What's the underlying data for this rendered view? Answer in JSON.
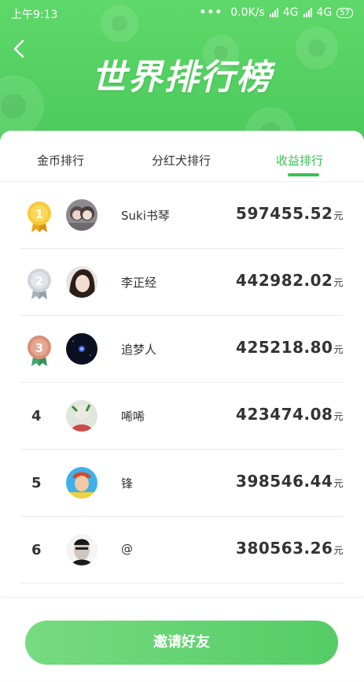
{
  "status_bar": {
    "time": "上午9:13",
    "speed": "0.0K/s",
    "network1": "4G",
    "network2": "4G",
    "battery": "57"
  },
  "header": {
    "title": "世界排行榜"
  },
  "tabs": [
    {
      "label": "金币排行",
      "active": false
    },
    {
      "label": "分红犬排行",
      "active": false
    },
    {
      "label": "收益排行",
      "active": true
    }
  ],
  "ranking": [
    {
      "rank": "1",
      "name": "Suki书琴",
      "amount": "597455.52",
      "unit": "元"
    },
    {
      "rank": "2",
      "name": "李正经",
      "amount": "442982.02",
      "unit": "元"
    },
    {
      "rank": "3",
      "name": "追梦人",
      "amount": "425218.80",
      "unit": "元"
    },
    {
      "rank": "4",
      "name": "唏唏",
      "amount": "423474.08",
      "unit": "元"
    },
    {
      "rank": "5",
      "name": "锋",
      "amount": "398546.44",
      "unit": "元"
    },
    {
      "rank": "6",
      "name": "@",
      "amount": "380563.26",
      "unit": "元"
    }
  ],
  "invite_button": "邀请好友",
  "colors": {
    "accent": "#3cbf55",
    "header": "#4fcf5e",
    "gold": "#f2c230",
    "silver": "#c6ccd2",
    "bronze": "#d7937a"
  }
}
